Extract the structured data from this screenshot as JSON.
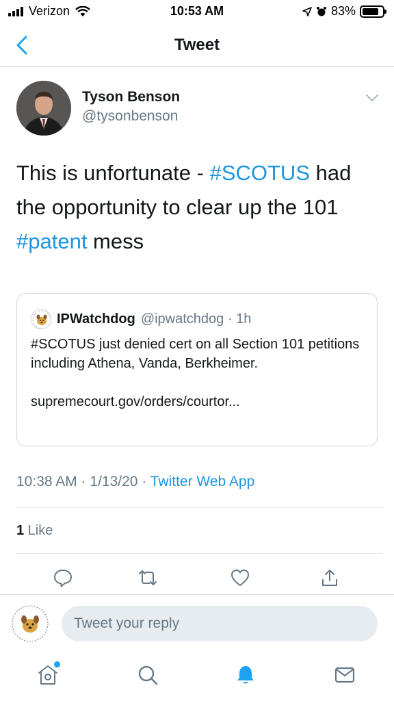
{
  "status_bar": {
    "carrier": "Verizon",
    "time": "10:53 AM",
    "battery_percent": "83%",
    "battery_level": 0.83
  },
  "header": {
    "title": "Tweet",
    "back_icon": "chevron-left-icon"
  },
  "tweet": {
    "author_name": "Tyson Benson",
    "author_handle": "@tysonbenson",
    "text_parts": {
      "p1": "This is unfortunate - ",
      "tag1": "#SCOTUS",
      "p2": " had the opportunity to clear up the 101 ",
      "tag2": "#patent",
      "p3": " mess"
    },
    "timestamp": "10:38 AM · 1/13/20 · ",
    "source": "Twitter Web App",
    "like_count": "1",
    "like_label": " Like"
  },
  "quoted_tweet": {
    "name": "IPWatchdog",
    "handle": "@ipwatchdog · 1h",
    "text": "#SCOTUS just denied cert on all Section 101 petitions including Athena, Vanda, Berkheimer.",
    "link": "supremecourt.gov/orders/courtor..."
  },
  "reply": {
    "placeholder": "Tweet your reply"
  },
  "colors": {
    "accent": "#1da1f2",
    "link": "#1b95e0",
    "secondary_text": "#657786"
  }
}
